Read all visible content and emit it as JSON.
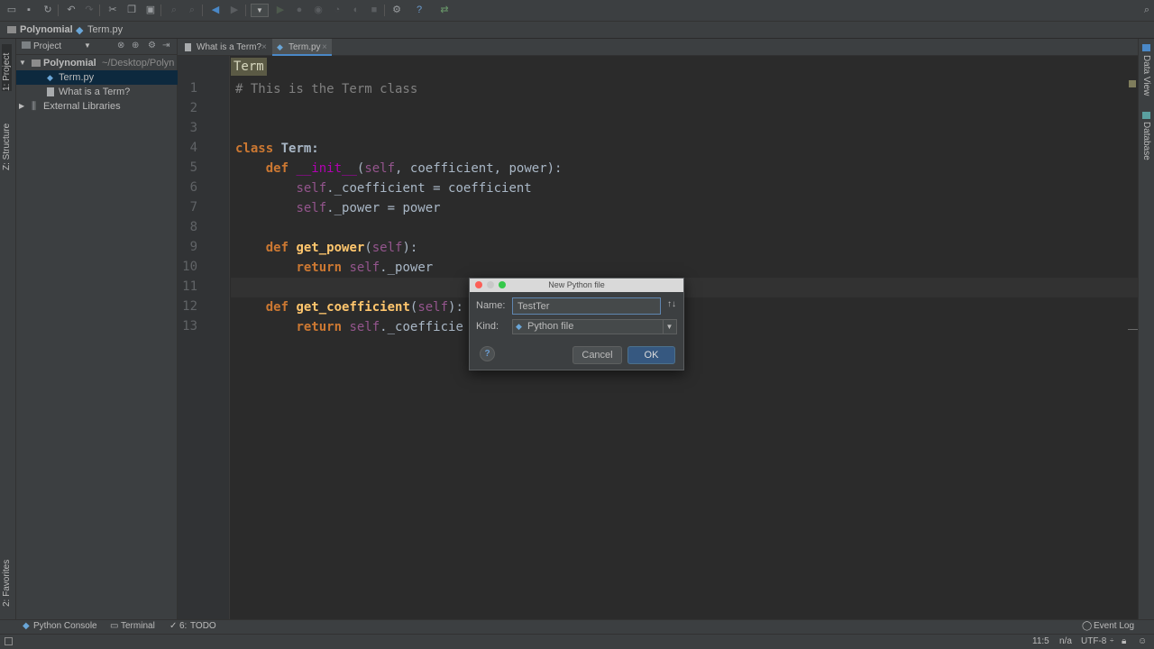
{
  "navbar": {
    "project": "Polynomial",
    "file": "Term.py"
  },
  "left_stripe": {
    "project_tab": "1: Project",
    "structure_tab": "Z: Structure",
    "favorites_tab": "2: Favorites"
  },
  "right_stripe": {
    "dataview_tab": "Data View",
    "database_tab": "Database"
  },
  "project_panel": {
    "header": "Project",
    "root": {
      "name": "Polynomial",
      "path": "~/Desktop/Polyn"
    },
    "items": [
      {
        "label": "Term.py"
      },
      {
        "label": "What is a Term?"
      },
      {
        "label": "External Libraries"
      }
    ]
  },
  "editor": {
    "tabs": [
      {
        "label": "What is a Term?"
      },
      {
        "label": "Term.py"
      }
    ],
    "breadcrumb": "Term",
    "line_numbers": [
      "1",
      "2",
      "3",
      "4",
      "5",
      "6",
      "7",
      "8",
      "9",
      "10",
      "11",
      "12",
      "13"
    ],
    "code": {
      "l1": "# This is the Term class",
      "l4_kw": "class",
      "l4_name": " Term:",
      "l5_kw": "def",
      "l5_fn": "__init__",
      "l5_self": "self",
      "l5_rest": ", coefficient, power):",
      "l6_self": "self",
      "l6_rest": "._coefficient = coefficient",
      "l7_self": "self",
      "l7_rest": "._power = power",
      "l9_kw": "def",
      "l9_fn": "get_power",
      "l9_self": "self",
      "l10_kw": "return",
      "l10_self": "self",
      "l10_rest": "._power",
      "l12_kw": "def",
      "l12_fn": "get_coefficient",
      "l12_self": "self",
      "l13_kw": "return",
      "l13_self": "self",
      "l13_rest": "._coefficie"
    }
  },
  "dialog": {
    "title": "New Python file",
    "name_label": "Name:",
    "name_value": "TestTer",
    "kind_label": "Kind:",
    "kind_value": "Python file",
    "help": "?",
    "cancel": "Cancel",
    "ok": "OK"
  },
  "bottom_tools": {
    "console": "Python Console",
    "terminal": "Terminal",
    "todo_num": "6:",
    "todo": "TODO",
    "event_log": "Event Log"
  },
  "statusbar": {
    "position": "11:5",
    "line_sep": "n/a",
    "encoding": "UTF-8"
  },
  "colors": {
    "accent": "#4a88c7",
    "ok_button": "#365880"
  }
}
